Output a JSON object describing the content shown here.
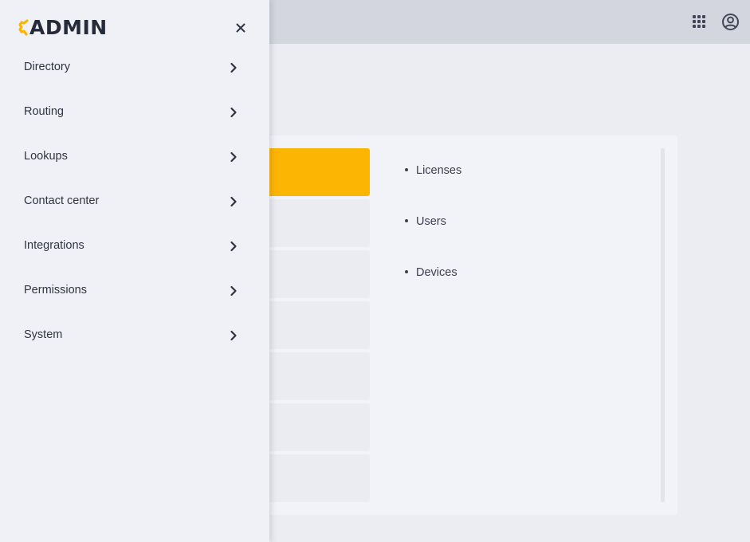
{
  "app": {
    "logo_text": "ADMIN",
    "accent_color": "#fdb504"
  },
  "sidebar": {
    "close_icon": "close-icon",
    "items": [
      {
        "label": "Directory",
        "icon": "chevron-right-icon"
      },
      {
        "label": "Routing",
        "icon": "chevron-right-icon"
      },
      {
        "label": "Lookups",
        "icon": "chevron-right-icon"
      },
      {
        "label": "Contact center",
        "icon": "chevron-right-icon"
      },
      {
        "label": "Integrations",
        "icon": "chevron-right-icon"
      },
      {
        "label": "Permissions",
        "icon": "chevron-right-icon"
      },
      {
        "label": "System",
        "icon": "chevron-right-icon"
      }
    ]
  },
  "topbar": {
    "apps_icon": "apps-grid-icon",
    "user_icon": "user-account-icon"
  },
  "content": {
    "tiles": [
      {
        "active": true
      },
      {
        "active": false
      },
      {
        "active": false
      },
      {
        "active": false
      },
      {
        "active": false
      },
      {
        "active": false
      },
      {
        "active": false
      }
    ],
    "links": [
      {
        "label": "Licenses"
      },
      {
        "label": "Users"
      },
      {
        "label": "Devices"
      }
    ]
  }
}
